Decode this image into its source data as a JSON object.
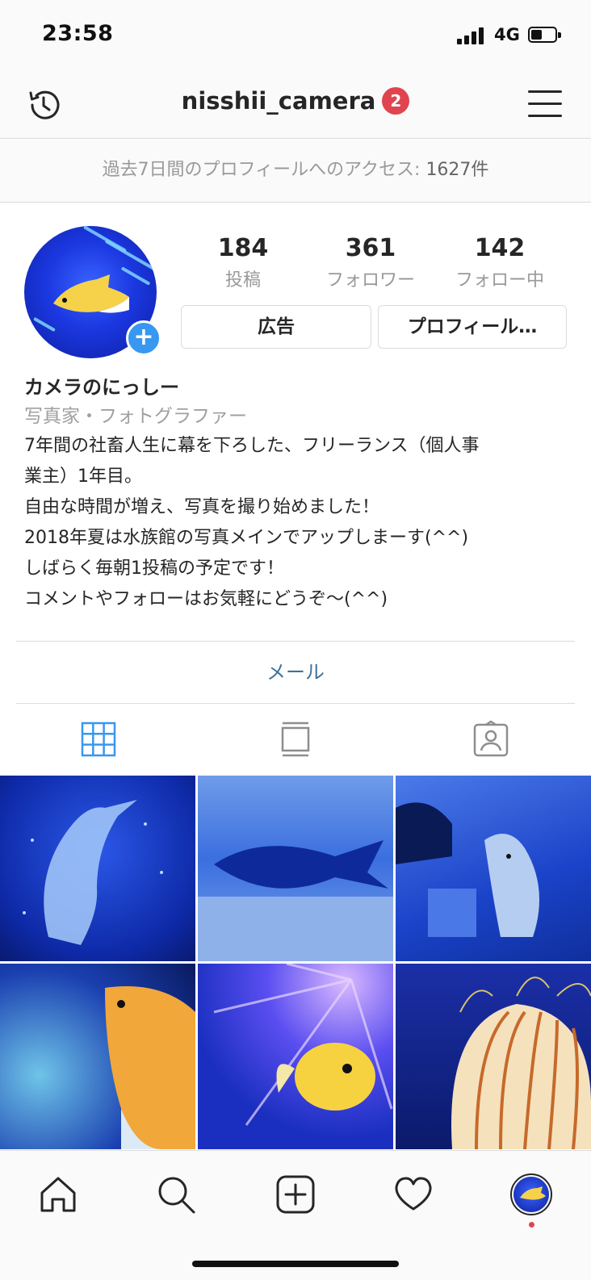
{
  "status": {
    "time": "23:58",
    "network": "4G"
  },
  "header": {
    "username": "nisshii_camera",
    "badge": "2"
  },
  "insights": {
    "label": "過去7日間のプロフィールへのアクセス: ",
    "count": "1627件"
  },
  "stats": [
    {
      "value": "184",
      "label": "投稿"
    },
    {
      "value": "361",
      "label": "フォロワー"
    },
    {
      "value": "142",
      "label": "フォロー中"
    }
  ],
  "buttons": {
    "ad": "広告",
    "edit_profile": "プロフィール…"
  },
  "bio": {
    "name": "カメラのにっしー",
    "category": "写真家・フォトグラファー",
    "lines": [
      "7年間の社畜人生に幕を下ろした、フリーランス（個人事",
      "業主）1年目。",
      "自由な時間が増え、写真を撮り始めました！",
      "2018年夏は水族館の写真メインでアップしまーす(^^)",
      "しばらく毎朝1投稿の予定です！",
      "コメントやフォローはお気軽にどうぞ〜(^^)"
    ]
  },
  "contact": {
    "email": "メール"
  },
  "tabs": [
    {
      "icon": "grid-icon",
      "active": true
    },
    {
      "icon": "feed-icon",
      "active": false
    },
    {
      "icon": "tagged-icon",
      "active": false
    }
  ],
  "grid": [
    {
      "subject": "dolphin"
    },
    {
      "subject": "fish"
    },
    {
      "subject": "dolphin"
    },
    {
      "subject": "goldfish"
    },
    {
      "subject": "goldfish"
    },
    {
      "subject": "jellyfish"
    }
  ],
  "bottom_nav": [
    "home-icon",
    "search-icon",
    "add-icon",
    "heart-icon",
    "profile-avatar"
  ],
  "colors": {
    "accent_blue": "#3897f0",
    "badge_red": "#e0454f",
    "link": "#3f729b"
  }
}
